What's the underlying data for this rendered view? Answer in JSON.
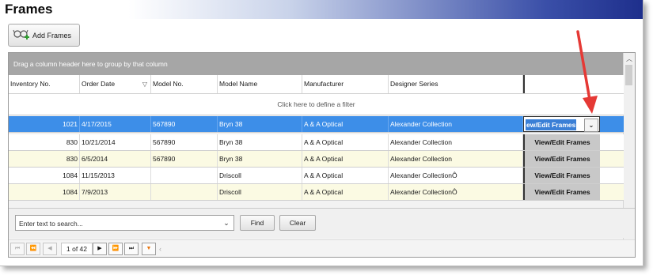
{
  "window": {
    "title": "Frames"
  },
  "toolbar": {
    "add_label": "Add Frames"
  },
  "grid": {
    "group_hint": "Drag a column header here to group by that column",
    "filter_hint": "Click here to define a filter",
    "columns": [
      "Inventory No.",
      "Order Date",
      "Model No.",
      "Model Name",
      "Manufacturer",
      "Designer Series"
    ],
    "sort_indicator": "▽",
    "rows": [
      {
        "inventory": "1021",
        "order_date": "4/17/2015",
        "model_no": "567890",
        "model_name": "Bryn 38",
        "manufacturer": "A & A Optical",
        "series": "Alexander Collection",
        "action": "ew/Edit Frames",
        "selected": true
      },
      {
        "inventory": "830",
        "order_date": "10/21/2014",
        "model_no": "567890",
        "model_name": "Bryn 38",
        "manufacturer": "A & A Optical",
        "series": "Alexander Collection",
        "action": "View/Edit Frames"
      },
      {
        "inventory": "830",
        "order_date": "6/5/2014",
        "model_no": "567890",
        "model_name": "Bryn 38",
        "manufacturer": "A & A Optical",
        "series": "Alexander Collection",
        "action": "View/Edit Frames"
      },
      {
        "inventory": "1084",
        "order_date": "11/15/2013",
        "model_no": "",
        "model_name": "Driscoll",
        "manufacturer": "A & A Optical",
        "series": "Alexander CollectionÔ",
        "action": "View/Edit Frames"
      },
      {
        "inventory": "1084",
        "order_date": "7/9/2013",
        "model_no": "",
        "model_name": "Driscoll",
        "manufacturer": "A & A Optical",
        "series": "Alexander CollectionÔ",
        "action": "View/Edit Frames"
      }
    ]
  },
  "search": {
    "placeholder": "Enter text to search...",
    "find_label": "Find",
    "clear_label": "Clear"
  },
  "pager": {
    "page_info": "1 of 42"
  },
  "colors": {
    "selected_row": "#3d8ee8",
    "alt_row": "#fbfae3",
    "annotation_arrow": "#e53935"
  },
  "icons": [
    "frames-add-icon",
    "chevron-down-icon",
    "filter-icon",
    "scroll-up-icon",
    "scroll-down-icon"
  ]
}
